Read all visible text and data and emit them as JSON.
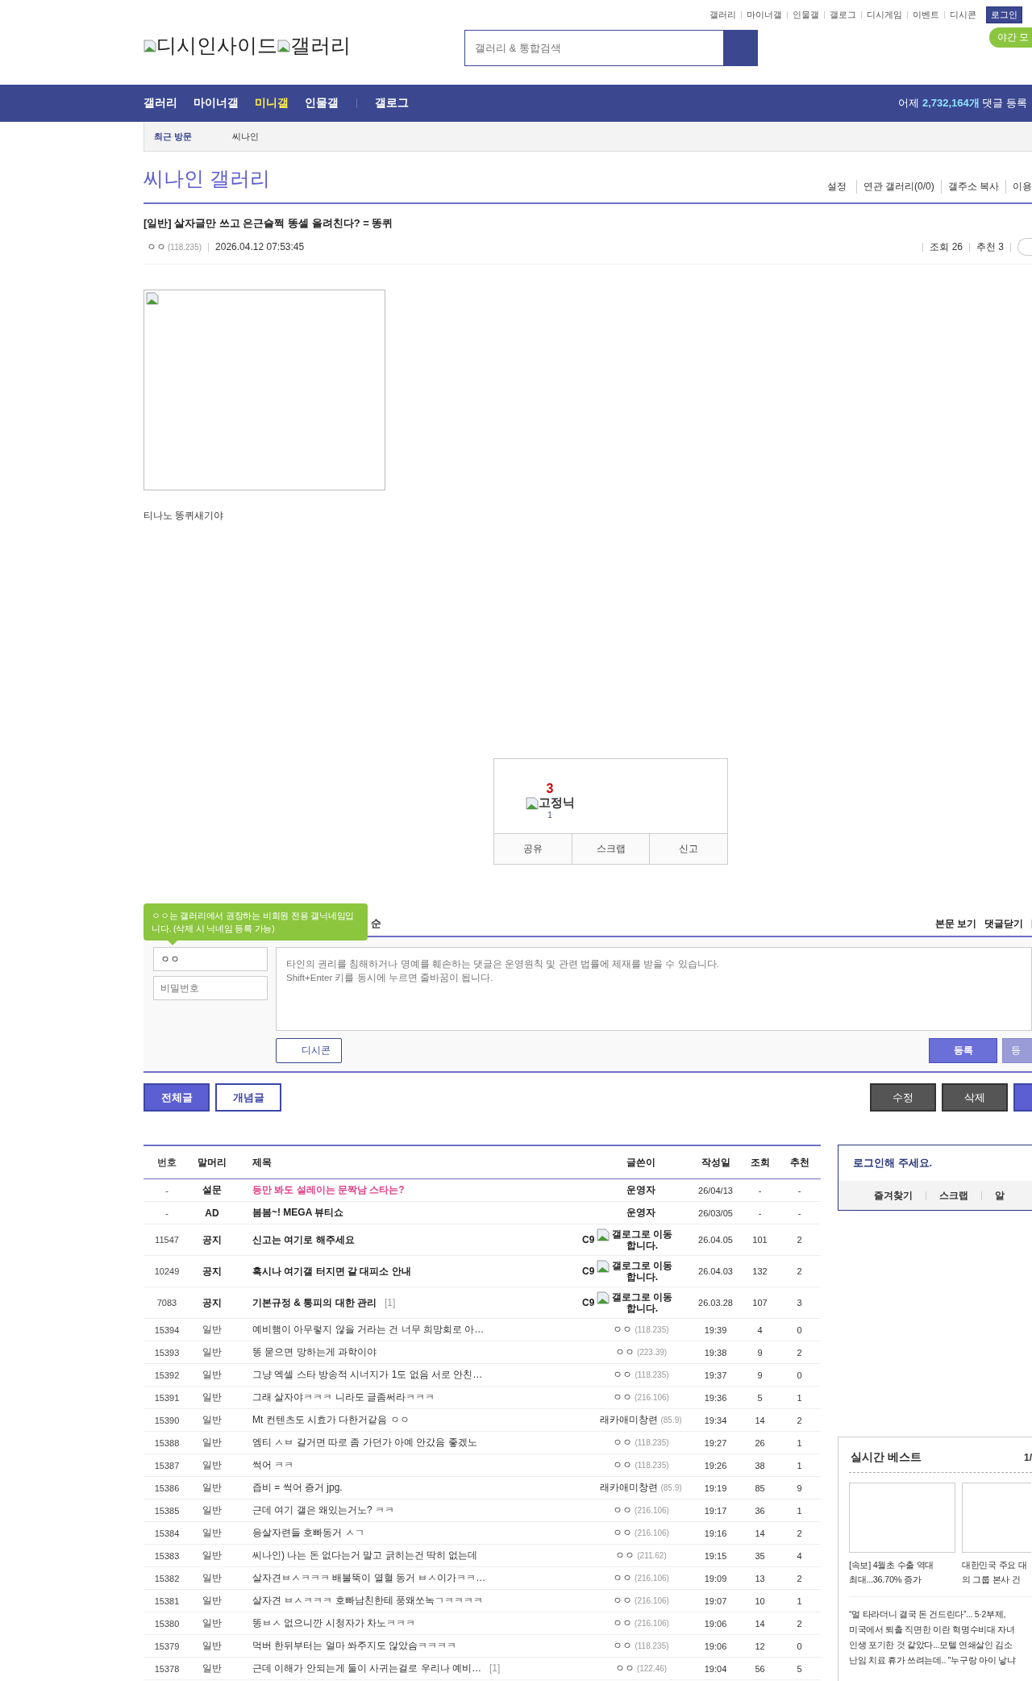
{
  "top_links": [
    "갤러리",
    "마이너갤",
    "인물갤",
    "갤로그",
    "디시게임",
    "이벤트",
    "디시콘"
  ],
  "login_button": "로그인",
  "night_mode": "야간 모",
  "logo": {
    "site": "디시인사이드",
    "section": "갤러리"
  },
  "search": {
    "placeholder": "갤러리 & 통합검색"
  },
  "nav": {
    "groups": [
      [
        {
          "label": "갤러리",
          "selected": false
        },
        {
          "label": "마이너갤",
          "selected": false
        },
        {
          "label": "미니갤",
          "selected": true
        },
        {
          "label": "인물갤",
          "selected": false
        }
      ],
      [
        {
          "label": "갤로그",
          "selected": false
        }
      ]
    ],
    "stats": {
      "prefix": "어제",
      "count": "2,732,164개",
      "suffix": "댓글 등록"
    }
  },
  "recent": {
    "label": "최근 방문",
    "items": [
      "씨나인"
    ]
  },
  "gallery": {
    "title": "씨나인 갤러리",
    "links": [
      "설정",
      "연관 갤러리(0/0)",
      "갤주소 복사",
      "이용"
    ]
  },
  "post": {
    "title": "[일반] 살자글만 쓰고 은근슬쩍 똥셀 올려친다? = 똥퀴",
    "author": "ㅇㅇ",
    "ip": "(118.235)",
    "date": "2026.04.12 07:53:45",
    "views": "조회 26",
    "recommends": "추천 3",
    "caption": "티나노 똥퀴새기야"
  },
  "vote": {
    "count": "3",
    "fixed_label": "고정닉",
    "fixed_count": "1",
    "actions": [
      "공유",
      "스크랩",
      "신고"
    ]
  },
  "comments": {
    "header_tail": "순",
    "links": [
      "본문 보기",
      "댓글닫기"
    ],
    "tooltip": "ㅇㅇ는 갤러리에서 권장하는 비회원 전용 갤닉네임입니다. (삭제 시 닉네임 등록 가능)",
    "name_value": "ㅇㅇ",
    "password_placeholder": "비밀번호",
    "placeholder": "타인의 권리를 침해하거나 명예를 훼손하는 댓글은 운영원칙 및 관련 법률에 제재를 받을 수 있습니다.\nShift+Enter 키를 동시에 누르면 줄바꿈이 됩니다.",
    "dccon": "디시콘",
    "submit": "등록",
    "submit_alt": "등"
  },
  "list_tabs": [
    {
      "label": "전체글",
      "selected": true
    },
    {
      "label": "개념글",
      "selected": false
    }
  ],
  "action_buttons": [
    "수정",
    "삭제"
  ],
  "table": {
    "columns": [
      "번호",
      "말머리",
      "제목",
      "글쓴이",
      "작성일",
      "조회",
      "추천"
    ],
    "rows": [
      {
        "kind": "survey",
        "number": "-",
        "head": "설문",
        "title": "등만 봐도 설레이는 문짝남 스타는?",
        "writer": "운영자",
        "date": "26/04/13",
        "views": "-",
        "recs": "-"
      },
      {
        "kind": "ad",
        "number": "-",
        "head": "AD",
        "title": "봄봄~! MEGA 뷰티쇼",
        "writer": "운영자",
        "date": "26/03/05",
        "views": "-",
        "recs": "-"
      },
      {
        "kind": "notice",
        "number": "11547",
        "head": "공지",
        "title": "신고는 여기로 해주세요",
        "writer": "C9",
        "writer_note": "갤로그로 이동합니다.",
        "date": "26.04.05",
        "views": "101",
        "recs": "2"
      },
      {
        "kind": "notice",
        "number": "10249",
        "head": "공지",
        "title": "혹시나 여기갤 터지면 갈 대피소 안내",
        "writer": "C9",
        "writer_note": "갤로그로 이동합니다.",
        "date": "26.04.03",
        "views": "132",
        "recs": "2"
      },
      {
        "kind": "notice",
        "number": "7083",
        "head": "공지",
        "title": "기본규정 & 통피의 대한 관리",
        "replies": "[1]",
        "writer": "C9",
        "writer_note": "갤로그로 이동합니다.",
        "date": "26.03.28",
        "views": "107",
        "recs": "3"
      },
      {
        "kind": "normal",
        "number": "15394",
        "head": "일반",
        "title": "예비햄이 아무렇지 않을 거라는 건 너무 희망회로 아…",
        "writer": "ㅇㅇ",
        "ip": "(118.235)",
        "date": "19:39",
        "views": "4",
        "recs": "0"
      },
      {
        "kind": "normal",
        "number": "15393",
        "head": "일반",
        "title": "똥 묻으면 망하는게 과학이야",
        "writer": "ㅇㅇ",
        "ip": "(223.39)",
        "date": "19:38",
        "views": "9",
        "recs": "2"
      },
      {
        "kind": "normal",
        "number": "15392",
        "head": "일반",
        "title": "그냥 엑셀 스타 방송적 시너지가 1도 없음 서로 안친…",
        "writer": "ㅇㅇ",
        "ip": "(118.235)",
        "date": "19:37",
        "views": "9",
        "recs": "0"
      },
      {
        "kind": "normal",
        "number": "15391",
        "head": "일반",
        "title": "그래 살자야ㅋㅋㅋ 니라도 글좀써라ㅋㅋㅋ",
        "writer": "ㅇㅇ",
        "ip": "(216.106)",
        "date": "19:36",
        "views": "5",
        "recs": "1"
      },
      {
        "kind": "normal",
        "number": "15390",
        "head": "일반",
        "title": "Mt 컨텐츠도 시효가 다한거같음 ㅇㅇ",
        "writer": "래카애미창련",
        "ip": "(85.9)",
        "date": "19:34",
        "views": "14",
        "recs": "2"
      },
      {
        "kind": "normal",
        "number": "15388",
        "head": "일반",
        "title": "엠티 ㅅㅂ 갈거면 따로 좀 가던가 아예 안갔음 좋겠노",
        "writer": "ㅇㅇ",
        "ip": "(118.235)",
        "date": "19:27",
        "views": "26",
        "recs": "1"
      },
      {
        "kind": "normal",
        "number": "15387",
        "head": "일반",
        "title": "썩어 ㅋㅋ",
        "writer": "ㅇㅇ",
        "ip": "(118.235)",
        "date": "19:26",
        "views": "38",
        "recs": "1"
      },
      {
        "kind": "normal",
        "number": "15386",
        "head": "일반",
        "title": "즙비 = 썩어 증거 jpg.",
        "writer": "래카애미창련",
        "ip": "(85.9)",
        "date": "19:19",
        "views": "85",
        "recs": "9"
      },
      {
        "kind": "normal",
        "number": "15385",
        "head": "일반",
        "title": "근데 여기 갤은 왜있는거노? ㅋㅋ",
        "writer": "ㅇㅇ",
        "ip": "(216.106)",
        "date": "19:17",
        "views": "36",
        "recs": "1"
      },
      {
        "kind": "normal",
        "number": "15384",
        "head": "일반",
        "title": "응살자련들 호빠동거 ㅅㄱ",
        "writer": "ㅇㅇ",
        "ip": "(216.106)",
        "date": "19:16",
        "views": "14",
        "recs": "2"
      },
      {
        "kind": "normal",
        "number": "15383",
        "head": "일반",
        "title": "씨나인) 나는 돈 없다는거 말고 긁히는건 딱히 없는데",
        "writer": "ㅇㅇ",
        "ip": "(211.62)",
        "date": "19:15",
        "views": "35",
        "recs": "4"
      },
      {
        "kind": "normal",
        "number": "15382",
        "head": "일반",
        "title": "살자견ㅂㅅㅋㅋㅋ 배불뚝이 열혈 동거 ㅂㅅ이가ㅋㅋ…",
        "writer": "ㅇㅇ",
        "ip": "(216.106)",
        "date": "19:09",
        "views": "13",
        "recs": "2"
      },
      {
        "kind": "normal",
        "number": "15381",
        "head": "일반",
        "title": "살자견 ㅂㅅㅋㅋㅋ 호빠남친한테 풍왜쏘녹ㄱㅋㅋㅋㅋ",
        "writer": "ㅇㅇ",
        "ip": "(216.106)",
        "date": "19:07",
        "views": "10",
        "recs": "1"
      },
      {
        "kind": "normal",
        "number": "15380",
        "head": "일반",
        "title": "똥ㅂㅅ 없으니깐 시청자가 차노ㅋㅋㅋ",
        "writer": "ㅇㅇ",
        "ip": "(216.106)",
        "date": "19:06",
        "views": "14",
        "recs": "2"
      },
      {
        "kind": "normal",
        "number": "15379",
        "head": "일반",
        "title": "먹버 한뒤부터는 얼마 쏴주지도 않았슴ㅋㅋㅋㅋ",
        "writer": "ㅇㅇ",
        "ip": "(118.235)",
        "date": "19:06",
        "views": "12",
        "recs": "0"
      },
      {
        "kind": "normal",
        "number": "15378",
        "head": "일반",
        "title": "근데 이해가 안되는게 둘이 사귀는걸로 우리나 예비…",
        "replies": "[1]",
        "writer": "ㅇㅇ",
        "ip": "(122.46)",
        "date": "19:04",
        "views": "56",
        "recs": "5"
      }
    ]
  },
  "sidebar": {
    "login_prompt": "로그인해 주세요.",
    "tabs": [
      "즐겨찾기",
      "스크랩",
      "알"
    ],
    "best": {
      "title": "실시간 베스트",
      "page": "1/",
      "cards": [
        "[속보] 4월초 수출 역대\n최대...36.70% 증가",
        "대한민국 주요 대\n의 그룹 본사 건"
      ],
      "headlines": [
        "“멀 타라더니 결국 돈 건드린다”... 5·2부제,",
        "미국에서 퇴출 직면한 이란 혁명수비대 자녀",
        "인생 포기한 것 같았다...모텔 연쇄살인 김소",
        "난임 치료 휴가 쓰려는데.. \"누구랑 아이 낳냐"
      ]
    }
  }
}
